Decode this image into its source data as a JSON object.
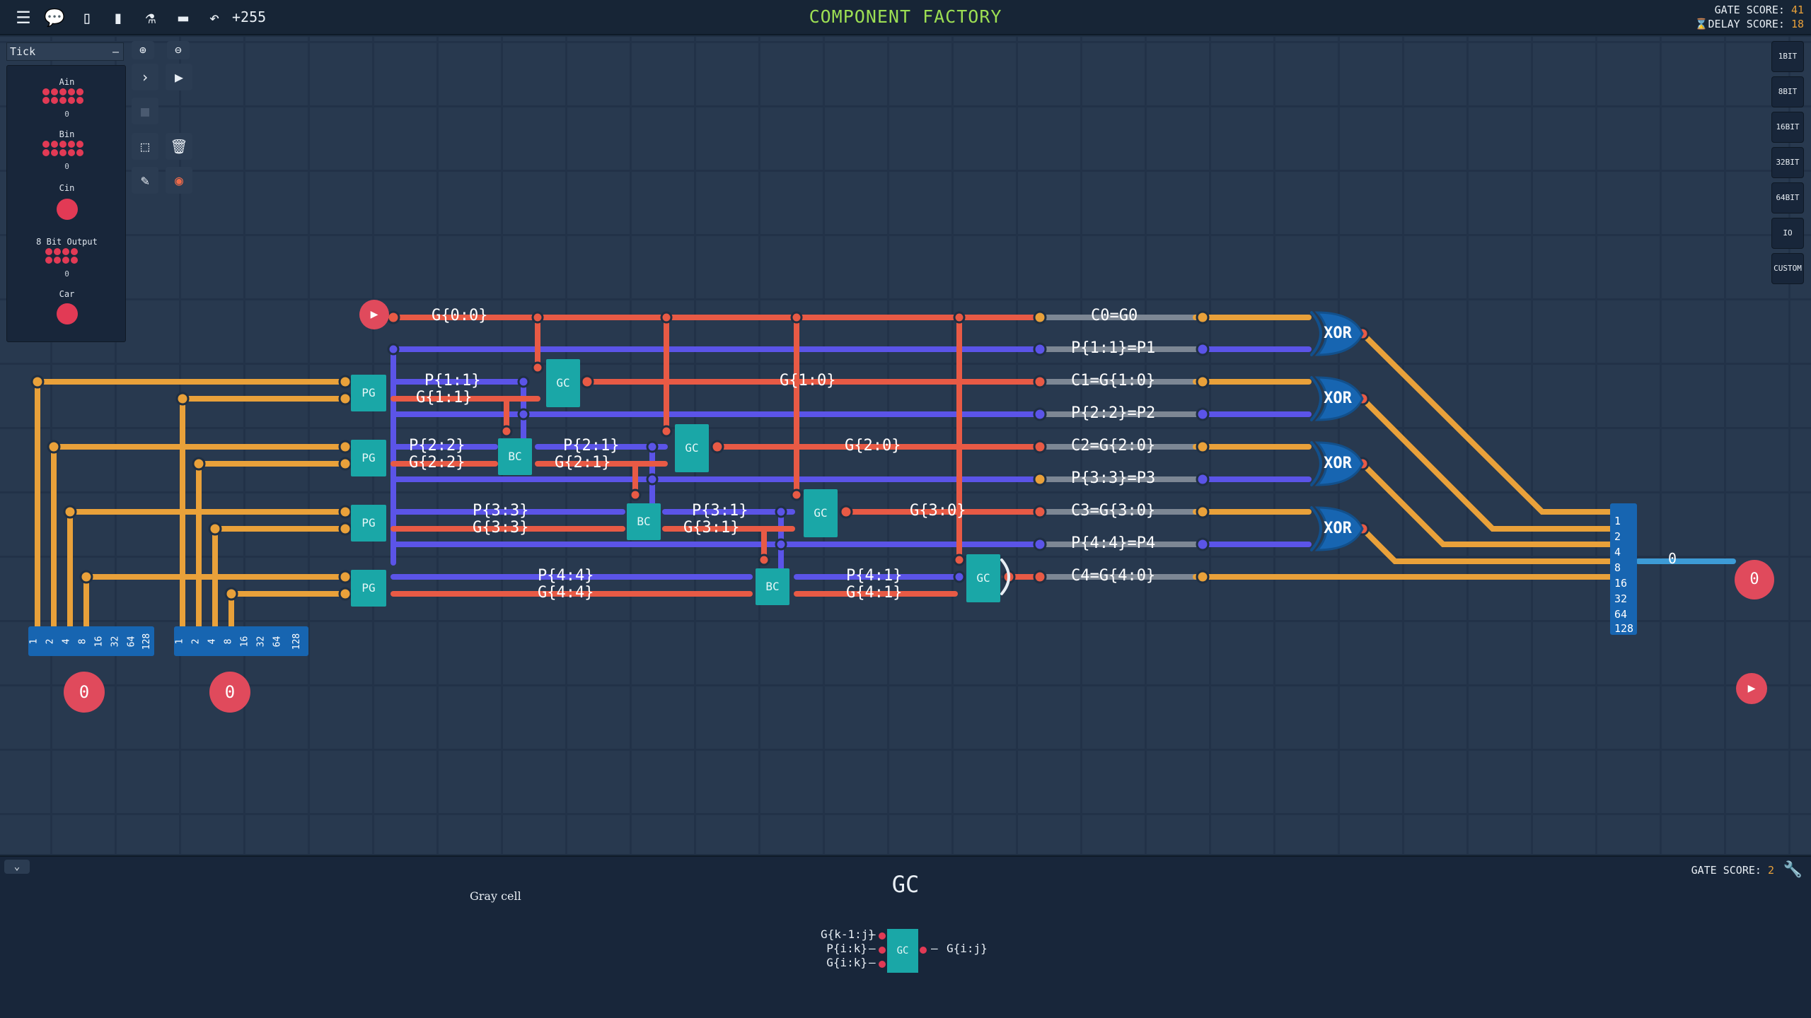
{
  "topbar": {
    "title": "COMPONENT FACTORY",
    "counter": "+255",
    "gate_score_label": "GATE SCORE:",
    "gate_score": "41",
    "delay_score_label": "DELAY SCORE:",
    "delay_score": "18",
    "icons": [
      "menu-icon",
      "chat-icon",
      "file-icon",
      "book-icon",
      "flask-icon",
      "tape-icon",
      "undo-icon"
    ]
  },
  "toolbar": {
    "tick_label": "Tick",
    "tick_minus": "–"
  },
  "inputs_panel": {
    "ain": "Ain",
    "ain_value": "0",
    "bin": "Bin",
    "bin_value": "0",
    "cin": "Cin",
    "output_8bit": "8 Bit Output",
    "output_value": "0",
    "car": "Car"
  },
  "side_buttons": [
    "1BIT",
    "8BIT",
    "16BIT",
    "32BIT",
    "64BIT",
    "IO",
    "CUSTOM"
  ],
  "components": {
    "pg": "PG",
    "bc": "BC",
    "gc": "GC",
    "xor": "XOR"
  },
  "wire_labels": [
    "G{0:0}",
    "P{1:1}",
    "G{1:1}",
    "P{2:2}",
    "G{2:2}",
    "P{2:1}",
    "G{2:1}",
    "P{3:3}",
    "G{3:3}",
    "P{3:1}",
    "G{3:1}",
    "P{4:4}",
    "G{4:4}",
    "P{4:1}",
    "G{4:1}",
    "G{1:0}",
    "G{2:0}",
    "G{3:0}",
    "C0=G0",
    "P{1:1}=P1",
    "C1=G{1:0}",
    "P{2:2}=P2",
    "C2=G{2:0}",
    "P{3:3}=P3",
    "C3=G{3:0}",
    "P{4:4}=P4",
    "C4=G{4:0}"
  ],
  "byte_bits": [
    "1",
    "2",
    "4",
    "8",
    "16",
    "32",
    "64",
    "128"
  ],
  "values": {
    "a_input": "0",
    "b_input": "0",
    "output_bus": "0",
    "output_node": "0"
  },
  "bottom": {
    "title": "GC",
    "description": "Gray cell",
    "gate_score_label": "GATE SCORE:",
    "gate_score": "2",
    "preview_component": "GC",
    "pin_g_k1j": "G{k-1:j}",
    "pin_p_ik": "P{i:k}",
    "pin_g_ik": "G{i:k}",
    "pin_g_ij": "G{i:j}"
  },
  "colors": {
    "orange": "#e9a13a",
    "red": "#e85a45",
    "blue": "#5b54e8",
    "gray": "#7d8794",
    "teal": "#1aa7a7",
    "title_green": "#9cde53"
  }
}
